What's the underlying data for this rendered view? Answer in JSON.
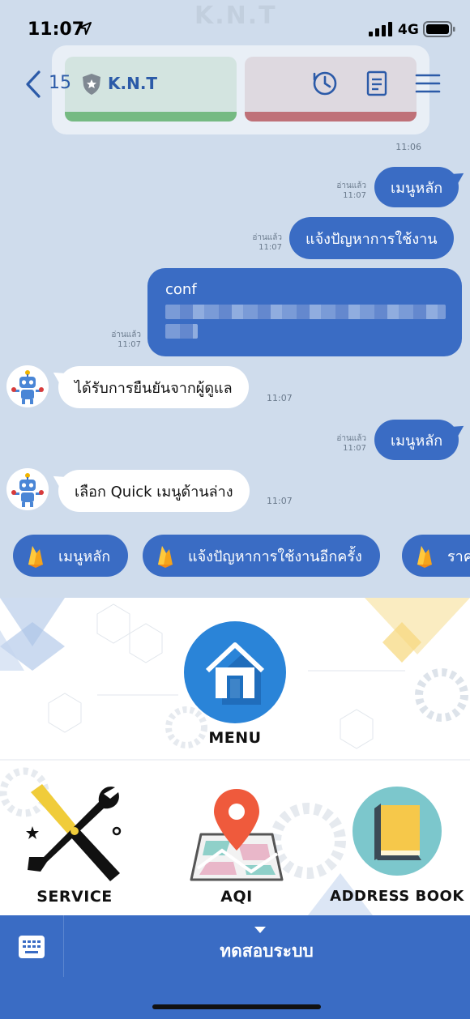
{
  "status_bar": {
    "time": "11:07",
    "network": "4G"
  },
  "watermark": "K.N.T",
  "header": {
    "back_count": "15",
    "title": "K.N.T"
  },
  "top_card": {
    "timestamp": "11:06"
  },
  "messages": [
    {
      "side": "right",
      "text": "เมนูหลัก",
      "read": "อ่านแล้ว",
      "time": "11:07"
    },
    {
      "side": "right",
      "text": "แจ้งปัญหาการใช้งาน",
      "read": "อ่านแล้ว",
      "time": "11:07"
    },
    {
      "side": "right",
      "text": "conf",
      "read": "อ่านแล้ว",
      "time": "11:07"
    },
    {
      "side": "left",
      "text": "ได้รับการยืนยันจากผู้ดูแล",
      "time": "11:07"
    },
    {
      "side": "right",
      "text": "เมนูหลัก",
      "read": "อ่านแล้ว",
      "time": "11:07"
    },
    {
      "side": "left",
      "text": "เลือก Quick เมนูด้านล่าง",
      "time": "11:07"
    }
  ],
  "quick_replies": [
    {
      "label": "เมนูหลัก"
    },
    {
      "label": "แจ้งปัญหาการใช้งานอีกครั้ง"
    },
    {
      "label": "ราค"
    }
  ],
  "rich_menu": {
    "menu_label": "MENU",
    "service_label": "SERVICE",
    "aqi_label": "AQI",
    "address_book_label": "ADDRESS BOOK"
  },
  "bottom_bar": {
    "label": "ทดสอบระบบ"
  },
  "colors": {
    "accent": "#3a6cc4",
    "chat_bg": "#cfdcec",
    "header_blue": "#2b5aa8"
  }
}
